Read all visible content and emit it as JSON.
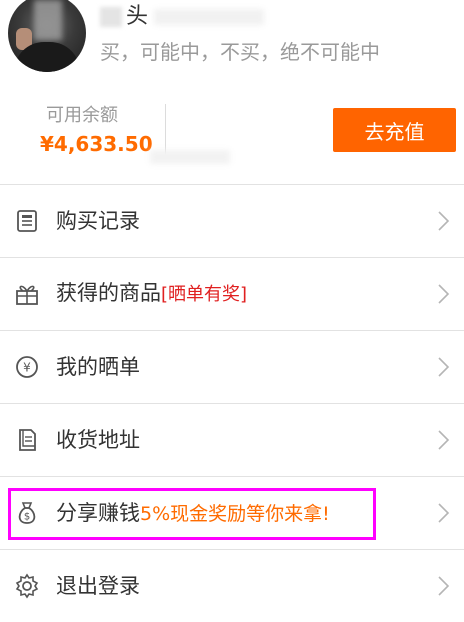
{
  "profile": {
    "username_visible": "头",
    "motto": "买，可能中，不买，绝不可能中"
  },
  "balance": {
    "label": "可用余额",
    "value": "¥4,633.50",
    "recharge_label": "去充值"
  },
  "menu": {
    "items": [
      {
        "label": "购买记录",
        "icon": "list-icon"
      },
      {
        "label": "获得的商品",
        "badge": "[晒单有奖]",
        "icon": "gift-icon"
      },
      {
        "label": "我的晒单",
        "icon": "yen-circle-icon"
      },
      {
        "label": "收货地址",
        "icon": "address-doc-icon"
      },
      {
        "label": "分享赚钱",
        "promo": "5%现金奖励等你来拿!",
        "icon": "money-bag-icon"
      },
      {
        "label": "退出登录",
        "icon": "settings-gear-icon"
      }
    ]
  },
  "colors": {
    "accent": "#ff6400",
    "promo_text": "#ff6b00",
    "badge_red": "#e02020",
    "highlight": "#ff00ff"
  }
}
